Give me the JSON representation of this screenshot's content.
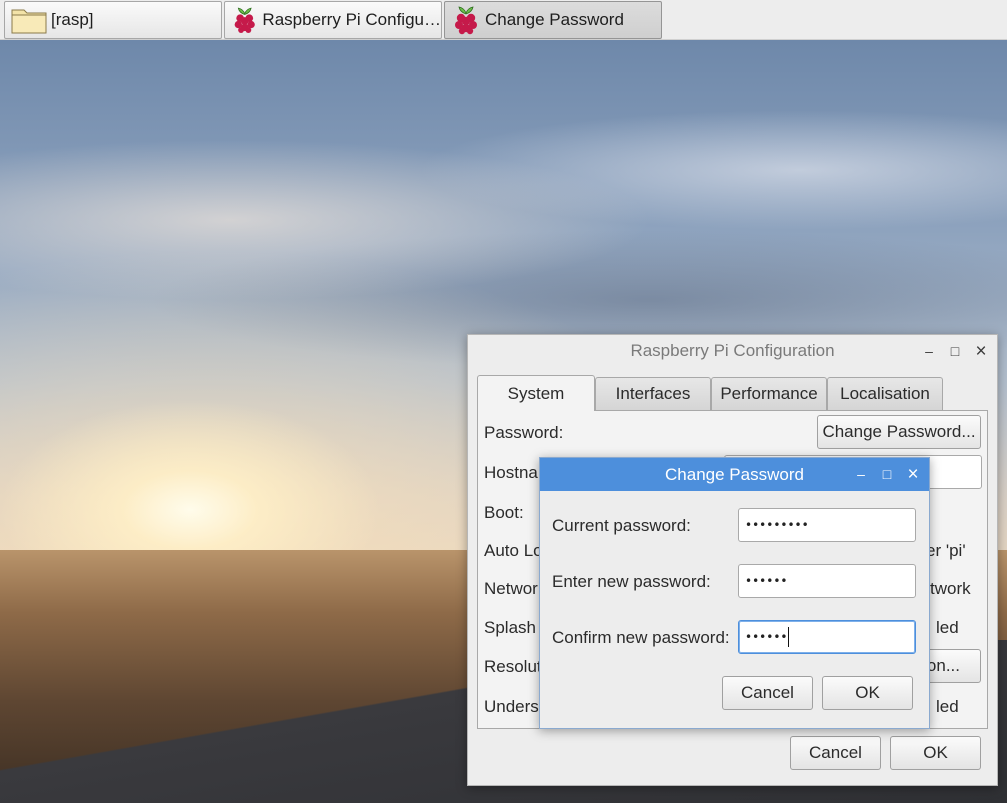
{
  "taskbar": {
    "items": [
      {
        "label": "[rasp]",
        "icon": "folder-icon",
        "active": false
      },
      {
        "label": "Raspberry Pi Configu…",
        "icon": "raspberry-icon",
        "active": false
      },
      {
        "label": "Change Password",
        "icon": "raspberry-icon",
        "active": true
      }
    ]
  },
  "config_window": {
    "title": "Raspberry Pi Configuration",
    "controls": {
      "minimize": "–",
      "maximize": "□",
      "close": "×"
    },
    "tabs": [
      {
        "label": "System",
        "active": true
      },
      {
        "label": "Interfaces",
        "active": false
      },
      {
        "label": "Performance",
        "active": false
      },
      {
        "label": "Localisation",
        "active": false
      }
    ],
    "rows": {
      "password": {
        "label": "Password:",
        "button": "Change Password..."
      },
      "hostname": {
        "label": "Hostna"
      },
      "boot": {
        "label": "Boot:"
      },
      "autologin": {
        "label": "Auto Lo",
        "value": "er 'pi'"
      },
      "network": {
        "label": "Networl",
        "value": "twork"
      },
      "splash": {
        "label": "Splash",
        "value": "led"
      },
      "resolution": {
        "label": "Resolut",
        "button": "on..."
      },
      "underscan": {
        "label": "Unders",
        "value": "led"
      }
    },
    "buttons": {
      "cancel": "Cancel",
      "ok": "OK"
    }
  },
  "password_dialog": {
    "title": "Change Password",
    "controls": {
      "minimize": "–",
      "maximize": "□",
      "close": "×"
    },
    "fields": {
      "current": {
        "label": "Current password:",
        "value": "•••••••••"
      },
      "new": {
        "label": "Enter new password:",
        "value": "••••••"
      },
      "confirm": {
        "label": "Confirm new password:",
        "value": "••••••"
      }
    },
    "buttons": {
      "cancel": "Cancel",
      "ok": "OK"
    }
  },
  "colors": {
    "dialog_titlebar": "#4d8fdc",
    "window_bg": "#ededed",
    "raspberry_red": "#c51a4a",
    "raspberry_leaf": "#6cc04a"
  }
}
